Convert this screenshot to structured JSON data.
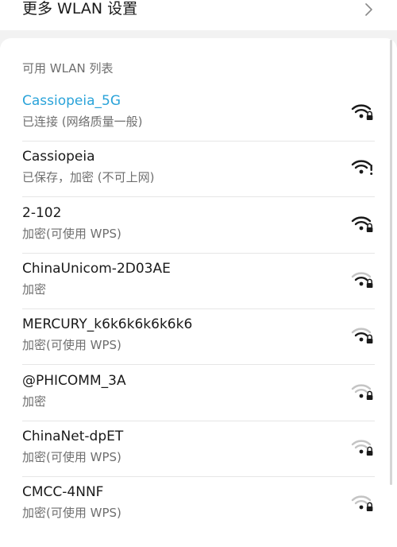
{
  "top": {
    "title": "更多 WLAN 设置"
  },
  "section": {
    "title": "可用 WLAN 列表"
  },
  "networks": [
    {
      "name": "Cassiopeia_5G",
      "status": "已连接 (网络质量一般)",
      "signal": 3,
      "icon": "wifi-lock-icon",
      "connected": true
    },
    {
      "name": "Cassiopeia",
      "status": "已保存，加密 (不可上网)",
      "signal": 3,
      "icon": "wifi-alert-icon",
      "connected": false
    },
    {
      "name": "2-102",
      "status": "加密(可使用 WPS)",
      "signal": 3,
      "icon": "wifi-lock-icon",
      "connected": false
    },
    {
      "name": "ChinaUnicom-2D03AE",
      "status": "加密",
      "signal": 2,
      "icon": "wifi-lock-icon",
      "connected": false
    },
    {
      "name": "MERCURY_k6k6k6k6k6k6",
      "status": "加密(可使用 WPS)",
      "signal": 2,
      "icon": "wifi-lock-icon",
      "connected": false
    },
    {
      "name": "@PHICOMM_3A",
      "status": "加密",
      "signal": 1,
      "icon": "wifi-lock-icon",
      "connected": false
    },
    {
      "name": "ChinaNet-dpET",
      "status": "加密(可使用 WPS)",
      "signal": 1,
      "icon": "wifi-lock-icon",
      "connected": false
    },
    {
      "name": "CMCC-4NNF",
      "status": "加密(可使用 WPS)",
      "signal": 1,
      "icon": "wifi-lock-icon",
      "connected": false
    }
  ],
  "colors": {
    "accent": "#2aa3d9",
    "text": "#1a1a1a",
    "secondary": "#6f6f6f",
    "icon_active": "#1a1a1a",
    "icon_inactive": "#c4c4c4"
  }
}
